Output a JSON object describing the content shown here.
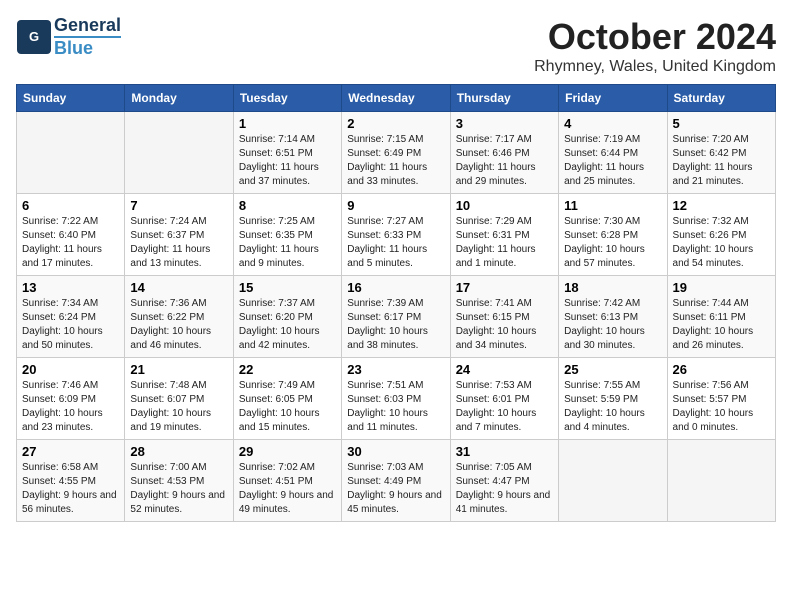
{
  "header": {
    "logo_general": "General",
    "logo_blue": "Blue",
    "title": "October 2024",
    "subtitle": "Rhymney, Wales, United Kingdom"
  },
  "days_of_week": [
    "Sunday",
    "Monday",
    "Tuesday",
    "Wednesday",
    "Thursday",
    "Friday",
    "Saturday"
  ],
  "weeks": [
    [
      {
        "day": "",
        "info": ""
      },
      {
        "day": "",
        "info": ""
      },
      {
        "day": "1",
        "info": "Sunrise: 7:14 AM\nSunset: 6:51 PM\nDaylight: 11 hours and 37 minutes."
      },
      {
        "day": "2",
        "info": "Sunrise: 7:15 AM\nSunset: 6:49 PM\nDaylight: 11 hours and 33 minutes."
      },
      {
        "day": "3",
        "info": "Sunrise: 7:17 AM\nSunset: 6:46 PM\nDaylight: 11 hours and 29 minutes."
      },
      {
        "day": "4",
        "info": "Sunrise: 7:19 AM\nSunset: 6:44 PM\nDaylight: 11 hours and 25 minutes."
      },
      {
        "day": "5",
        "info": "Sunrise: 7:20 AM\nSunset: 6:42 PM\nDaylight: 11 hours and 21 minutes."
      }
    ],
    [
      {
        "day": "6",
        "info": "Sunrise: 7:22 AM\nSunset: 6:40 PM\nDaylight: 11 hours and 17 minutes."
      },
      {
        "day": "7",
        "info": "Sunrise: 7:24 AM\nSunset: 6:37 PM\nDaylight: 11 hours and 13 minutes."
      },
      {
        "day": "8",
        "info": "Sunrise: 7:25 AM\nSunset: 6:35 PM\nDaylight: 11 hours and 9 minutes."
      },
      {
        "day": "9",
        "info": "Sunrise: 7:27 AM\nSunset: 6:33 PM\nDaylight: 11 hours and 5 minutes."
      },
      {
        "day": "10",
        "info": "Sunrise: 7:29 AM\nSunset: 6:31 PM\nDaylight: 11 hours and 1 minute."
      },
      {
        "day": "11",
        "info": "Sunrise: 7:30 AM\nSunset: 6:28 PM\nDaylight: 10 hours and 57 minutes."
      },
      {
        "day": "12",
        "info": "Sunrise: 7:32 AM\nSunset: 6:26 PM\nDaylight: 10 hours and 54 minutes."
      }
    ],
    [
      {
        "day": "13",
        "info": "Sunrise: 7:34 AM\nSunset: 6:24 PM\nDaylight: 10 hours and 50 minutes."
      },
      {
        "day": "14",
        "info": "Sunrise: 7:36 AM\nSunset: 6:22 PM\nDaylight: 10 hours and 46 minutes."
      },
      {
        "day": "15",
        "info": "Sunrise: 7:37 AM\nSunset: 6:20 PM\nDaylight: 10 hours and 42 minutes."
      },
      {
        "day": "16",
        "info": "Sunrise: 7:39 AM\nSunset: 6:17 PM\nDaylight: 10 hours and 38 minutes."
      },
      {
        "day": "17",
        "info": "Sunrise: 7:41 AM\nSunset: 6:15 PM\nDaylight: 10 hours and 34 minutes."
      },
      {
        "day": "18",
        "info": "Sunrise: 7:42 AM\nSunset: 6:13 PM\nDaylight: 10 hours and 30 minutes."
      },
      {
        "day": "19",
        "info": "Sunrise: 7:44 AM\nSunset: 6:11 PM\nDaylight: 10 hours and 26 minutes."
      }
    ],
    [
      {
        "day": "20",
        "info": "Sunrise: 7:46 AM\nSunset: 6:09 PM\nDaylight: 10 hours and 23 minutes."
      },
      {
        "day": "21",
        "info": "Sunrise: 7:48 AM\nSunset: 6:07 PM\nDaylight: 10 hours and 19 minutes."
      },
      {
        "day": "22",
        "info": "Sunrise: 7:49 AM\nSunset: 6:05 PM\nDaylight: 10 hours and 15 minutes."
      },
      {
        "day": "23",
        "info": "Sunrise: 7:51 AM\nSunset: 6:03 PM\nDaylight: 10 hours and 11 minutes."
      },
      {
        "day": "24",
        "info": "Sunrise: 7:53 AM\nSunset: 6:01 PM\nDaylight: 10 hours and 7 minutes."
      },
      {
        "day": "25",
        "info": "Sunrise: 7:55 AM\nSunset: 5:59 PM\nDaylight: 10 hours and 4 minutes."
      },
      {
        "day": "26",
        "info": "Sunrise: 7:56 AM\nSunset: 5:57 PM\nDaylight: 10 hours and 0 minutes."
      }
    ],
    [
      {
        "day": "27",
        "info": "Sunrise: 6:58 AM\nSunset: 4:55 PM\nDaylight: 9 hours and 56 minutes."
      },
      {
        "day": "28",
        "info": "Sunrise: 7:00 AM\nSunset: 4:53 PM\nDaylight: 9 hours and 52 minutes."
      },
      {
        "day": "29",
        "info": "Sunrise: 7:02 AM\nSunset: 4:51 PM\nDaylight: 9 hours and 49 minutes."
      },
      {
        "day": "30",
        "info": "Sunrise: 7:03 AM\nSunset: 4:49 PM\nDaylight: 9 hours and 45 minutes."
      },
      {
        "day": "31",
        "info": "Sunrise: 7:05 AM\nSunset: 4:47 PM\nDaylight: 9 hours and 41 minutes."
      },
      {
        "day": "",
        "info": ""
      },
      {
        "day": "",
        "info": ""
      }
    ]
  ]
}
